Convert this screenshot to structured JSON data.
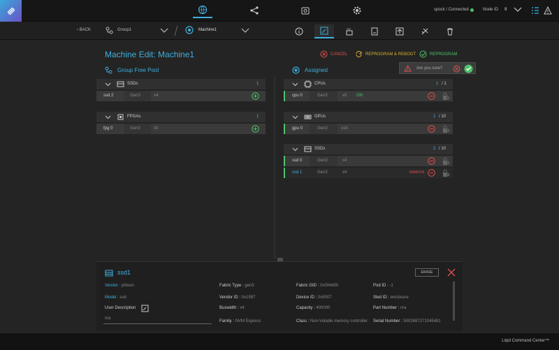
{
  "topbar": {
    "status": "spock / Connected",
    "node_id_label": "Node ID",
    "node_id_value": "9"
  },
  "subbar": {
    "back_label": "BACK",
    "group_label": "Group1",
    "machine_label": "Machine1"
  },
  "page": {
    "title": "Machine Edit: Machine1",
    "cancel_label": "CANCEL",
    "reprogram_reboot_label": "REPROGRAM & REBOOT",
    "reprogram_label": "REPROGRAM",
    "confirm_text": "Are you sure?"
  },
  "left_panel": {
    "title": "Group Free Pool",
    "ssds": {
      "label": "SSDs",
      "count": "1",
      "rows": [
        {
          "name": "ssd 2",
          "gen": "Gen3",
          "lanes": "x4"
        }
      ]
    },
    "fpgas": {
      "label": "FPGAs",
      "count": "1",
      "rows": [
        {
          "name": "fpg 0",
          "gen": "Gen3",
          "lanes": "x0"
        }
      ]
    }
  },
  "right_panel": {
    "title": "Assigned",
    "cpus": {
      "label": "CPUs",
      "count": "1",
      "total": "/ 1",
      "rows": [
        {
          "name": "cpu 0",
          "gen": "Gen3",
          "lanes": "x0",
          "status": "ON"
        }
      ]
    },
    "gpus": {
      "label": "GPUs",
      "count": "1",
      "total": "/ 10",
      "rows": [
        {
          "name": "gpu 0",
          "gen": "Gen3",
          "lanes": "x16"
        }
      ]
    },
    "ssds": {
      "label": "SSDs",
      "count": "2",
      "total": "/ 10",
      "rows": [
        {
          "name": "ssd 0",
          "gen": "Gen3",
          "lanes": "x4"
        },
        {
          "name": "ssd 1",
          "gen": "Gen3",
          "lanes": "x4",
          "status": "REMOVE"
        }
      ]
    }
  },
  "detail": {
    "title": "ssd1",
    "erase_label": "ERASE",
    "vendor_label": "Vendor",
    "vendor_value": "phison",
    "model_label": "Model",
    "model_value": "ssd",
    "user_description_label": "User Description",
    "user_description_value": "n/a",
    "fabric_type_label": "Fabric Type",
    "fabric_type_value": "gen3",
    "vendor_id_label": "Vendor ID",
    "vendor_id_value": "0x1987",
    "buswidth_label": "Buswidth",
    "buswidth_value": "x4",
    "family_label": "Family",
    "family_value": "NVM Express",
    "fabric_gid_label": "Fabric GID",
    "fabric_gid_value": "0x004d00",
    "device_id_label": "Device ID",
    "device_id_value": "0x5007",
    "capacity_label": "Capacity",
    "capacity_value": "400000",
    "class_label": "Class",
    "class_value": "Non-Volatile memory controller",
    "pod_id_label": "Pod ID",
    "pod_id_value": "-1",
    "sled_id_label": "Sled ID",
    "sled_id_value": "enclosure",
    "part_number_label": "Part Number",
    "part_number_value": "n/a",
    "serial_number_label": "Serial Number",
    "serial_number_value": "5002687271045481"
  },
  "footer": {
    "text": "Liqid Command Center™"
  },
  "colors": {
    "accent": "#3fb0e0",
    "green": "#4ec26a",
    "red": "#e05050",
    "gold": "#d8b030"
  }
}
